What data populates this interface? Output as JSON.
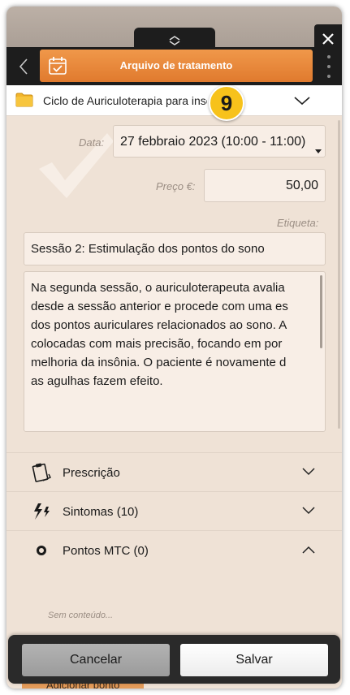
{
  "header": {
    "title": "Arquivo de tratamento"
  },
  "cycle": {
    "name": "Ciclo de Auriculoterapia para insônia",
    "badge": "9"
  },
  "form": {
    "date_label": "Data:",
    "date_value": "27 febbraio 2023 (10:00 - 11:00)",
    "price_label": "Preço €:",
    "price_value": "50,00",
    "tag_label": "Etiqueta:",
    "tag_value": "Sessão 2: Estimulação dos pontos do sono",
    "description_lines": [
      "Na segunda sessão, o auriculoterapeuta avalia",
      "desde a sessão anterior e procede com uma es",
      "dos pontos auriculares relacionados ao sono. A",
      "colocadas com mais precisão, focando em por",
      "melhoria da insônia. O paciente é novamente d",
      "as agulhas fazem efeito."
    ]
  },
  "sections": [
    {
      "label": "Prescrição",
      "icon": "clipboard-icon",
      "state": "collapsed"
    },
    {
      "label": "Sintomas (10)",
      "icon": "lightning-icon",
      "state": "collapsed"
    },
    {
      "label": "Pontos MTC (0)",
      "icon": "dot-icon",
      "state": "expanded"
    }
  ],
  "tcm_points": {
    "empty_text": "Sem conteúdo...",
    "add_button": "Adicionar ponto"
  },
  "footer": {
    "cancel_label": "Cancelar",
    "save_label": "Salvar"
  },
  "colors": {
    "accent": "#e8883a",
    "background": "#efe2d6",
    "header": "#1d1d1d",
    "badge": "#f7c21b"
  }
}
